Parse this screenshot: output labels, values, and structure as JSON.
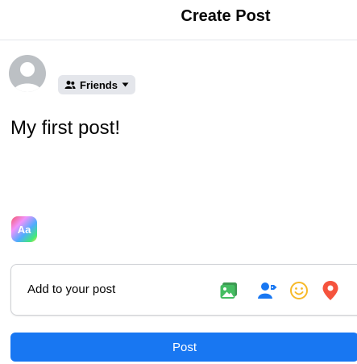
{
  "header": {
    "title": "Create Post"
  },
  "composer": {
    "audience_label": "Friends",
    "post_text": "My first post!",
    "text_format_label": "Aa"
  },
  "add_to_post": {
    "label": "Add to your post",
    "tools": [
      {
        "icon": "photo-video-icon",
        "color": "#45bd62"
      },
      {
        "icon": "tag-people-icon",
        "color": "#1877f2"
      },
      {
        "icon": "feeling-icon",
        "color": "#f7b928"
      },
      {
        "icon": "check-in-icon",
        "color": "#f5533d"
      }
    ]
  },
  "actions": {
    "post_label": "Post"
  },
  "colors": {
    "primary": "#1877f2",
    "divider": "#e4e6eb"
  }
}
